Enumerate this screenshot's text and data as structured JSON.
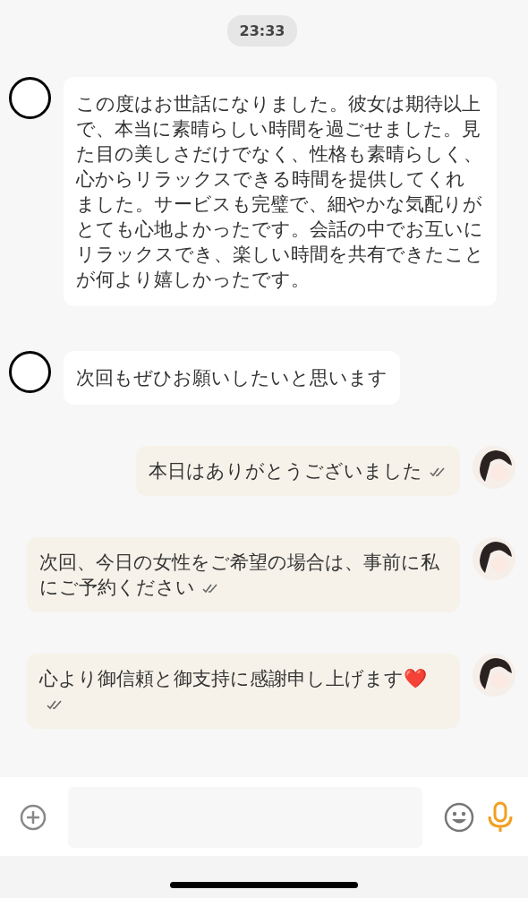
{
  "time_label": "23:33",
  "messages": [
    {
      "kind": "incoming",
      "text": "この度はお世話になりました。彼女は期待以上で、本当に素晴らしい時間を過ごせました。見た目の美しさだけでなく、性格も素晴らしく、心からリラックスできる時間を提供してくれました。サービスも完璧で、細やかな気配りがとても心地よかったです。会話の中でお互いにリラックスでき、楽しい時間を共有できたことが何より嬉しかったです。",
      "read": false
    },
    {
      "kind": "incoming",
      "text": "次回もぜひお願いしたいと思います",
      "read": false
    },
    {
      "kind": "outgoing",
      "text": "本日はありがとうございました",
      "read": true
    },
    {
      "kind": "outgoing",
      "text": "次回、今日の女性をご希望の場合は、事前に私にご予約ください",
      "read": true
    },
    {
      "kind": "outgoing",
      "text": "心より御信頼と御支持に感謝申し上げます❤️",
      "read": true
    }
  ]
}
